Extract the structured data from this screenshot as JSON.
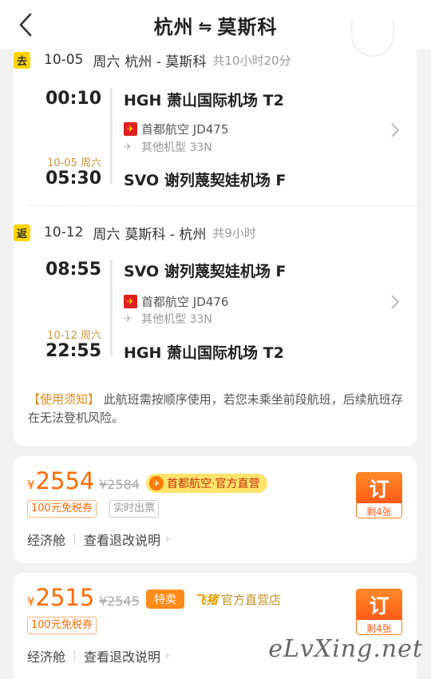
{
  "header": {
    "title_from": "杭州",
    "title_arrow": "⇋",
    "title_to": "莫斯科"
  },
  "outbound": {
    "tag": "去",
    "date": "10-05",
    "weekday": "周六",
    "route": "杭州 - 莫斯科",
    "duration": "共10小时20分",
    "dep_time": "00:10",
    "dep_airport": "HGH 萧山国际机场 T2",
    "airline": "首都航空 JD475",
    "aircraft": "其他机型 33N",
    "arr_date": "10-05 周六",
    "arr_time": "05:30",
    "arr_airport": "SVO 谢列蔑契娃机场 F"
  },
  "inbound": {
    "tag": "返",
    "date": "10-12",
    "weekday": "周六",
    "route": "莫斯科 - 杭州",
    "duration": "共9小时",
    "dep_time": "08:55",
    "dep_airport": "SVO 谢列蔑契娃机场 F",
    "airline": "首都航空 JD476",
    "aircraft": "其他机型 33N",
    "arr_date": "10-12 周六",
    "arr_time": "22:55",
    "arr_airport": "HGH 萧山国际机场 T2"
  },
  "notice": {
    "label": "【使用须知】",
    "text": "此航班需按顺序使用，若您未乘坐前段航班，后续航班存在无法登机风险。"
  },
  "offers": [
    {
      "currency": "¥",
      "price": "2554",
      "old_price": "¥2584",
      "brand": "首都航空·官方直营",
      "coupon": "100元免税券",
      "ticket": "实时出票",
      "cabin": "经济舱",
      "refund": "查看退改说明",
      "book": "订",
      "remaining": "剩4张"
    },
    {
      "currency": "¥",
      "price": "2515",
      "old_price": "¥2545",
      "special": "特卖",
      "feizhu_logo": "飞猪",
      "feizhu_text": "官方直营店",
      "coupon": "100元免税券",
      "cabin": "经济舱",
      "refund": "查看退改说明",
      "book": "订",
      "remaining": "剩4张"
    }
  ],
  "watermark": "eLvXing.net",
  "colors": {
    "accent": "#ff6a00",
    "tag": "#ffd400",
    "airline_logo": "#e02020"
  },
  "icons": {
    "back": "chevron-left-icon",
    "airline": "capital-airlines-logo",
    "aircraft": "plane-icon",
    "detail": "chevron-right-icon"
  }
}
